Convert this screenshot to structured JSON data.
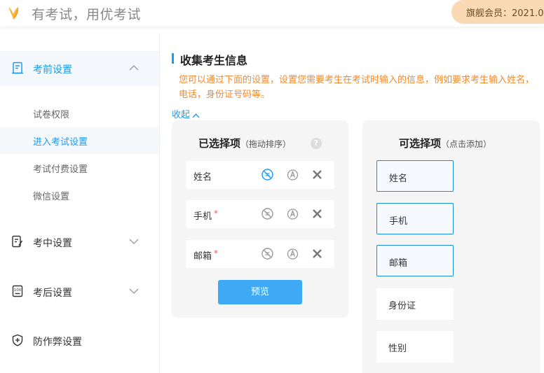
{
  "app": {
    "brand": "有考试，用优考试",
    "member": "旗舰会员：2021.0"
  },
  "sidebar": {
    "items": [
      {
        "label": "考前设置",
        "icon": "document-icon"
      },
      {
        "label": "考中设置",
        "icon": "edit-document-icon"
      },
      {
        "label": "考后设置",
        "icon": "score-document-icon"
      },
      {
        "label": "防作弊设置",
        "icon": "shield-icon"
      }
    ],
    "subitems": [
      {
        "label": "试卷权限"
      },
      {
        "label": "进入考试设置"
      },
      {
        "label": "考试付费设置"
      },
      {
        "label": "微信设置"
      }
    ]
  },
  "main": {
    "section_title": "收集考生信息",
    "notice": "您可以通过下面的设置，设置您需要考生在考试时输入的信息，例如要求考生输入姓名，电话，身份证号码等。",
    "collapse_label": "收起",
    "selected_panel": {
      "title": "已选择项",
      "hint": "（拖动排序）",
      "help": "?",
      "rows": [
        {
          "label": "姓名",
          "required": ""
        },
        {
          "label": "手机",
          "required": "*"
        },
        {
          "label": "邮箱",
          "required": "*"
        }
      ],
      "preview_label": "预览"
    },
    "available_panel": {
      "title": "可选择项",
      "hint": "（点击添加）",
      "options": [
        {
          "label": "姓名",
          "chosen": true
        },
        {
          "label": "手机",
          "chosen": true
        },
        {
          "label": "邮箱",
          "chosen": true
        },
        {
          "label": "身份证",
          "chosen": false
        },
        {
          "label": "性别",
          "chosen": false
        }
      ]
    }
  },
  "colors": {
    "accent": "#1d9bf0",
    "notice": "#f28a2d",
    "member_bg": "#fbd9b4",
    "required": "#f25a5a"
  }
}
